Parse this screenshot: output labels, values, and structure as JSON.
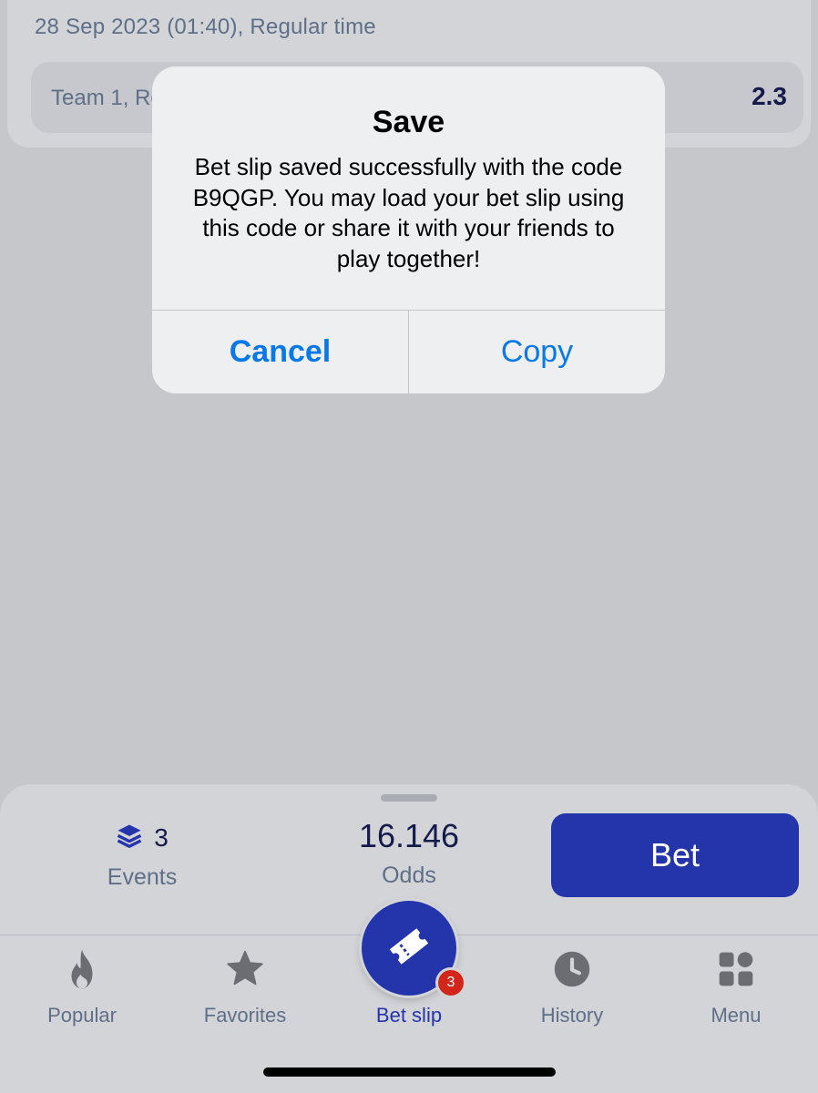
{
  "match": {
    "date_line": "28 Sep 2023 (01:40), Regular time",
    "outcome_label": "Team 1, Re",
    "outcome_odds": "2.3"
  },
  "alert": {
    "title": "Save",
    "message": "Bet slip saved successfully with the code B9QGP. You may load your bet slip using this code or share it with your friends to play together!",
    "cancel_label": "Cancel",
    "copy_label": "Copy"
  },
  "summary": {
    "events_count": "3",
    "events_label": "Events",
    "odds_value": "16.146",
    "odds_label": "Odds",
    "bet_label": "Bet"
  },
  "tabs": [
    {
      "label": "Popular",
      "icon": "flame-icon"
    },
    {
      "label": "Favorites",
      "icon": "star-icon"
    },
    {
      "label": "Bet slip",
      "icon": "ticket-icon",
      "badge": "3",
      "active": true
    },
    {
      "label": "History",
      "icon": "clock-icon"
    },
    {
      "label": "Menu",
      "icon": "grid-icon"
    }
  ],
  "colors": {
    "accent": "#2434ab",
    "link": "#0a79e8",
    "badge": "#d3261b",
    "muted_text": "#5f6f87",
    "dark_text": "#141a4a"
  }
}
